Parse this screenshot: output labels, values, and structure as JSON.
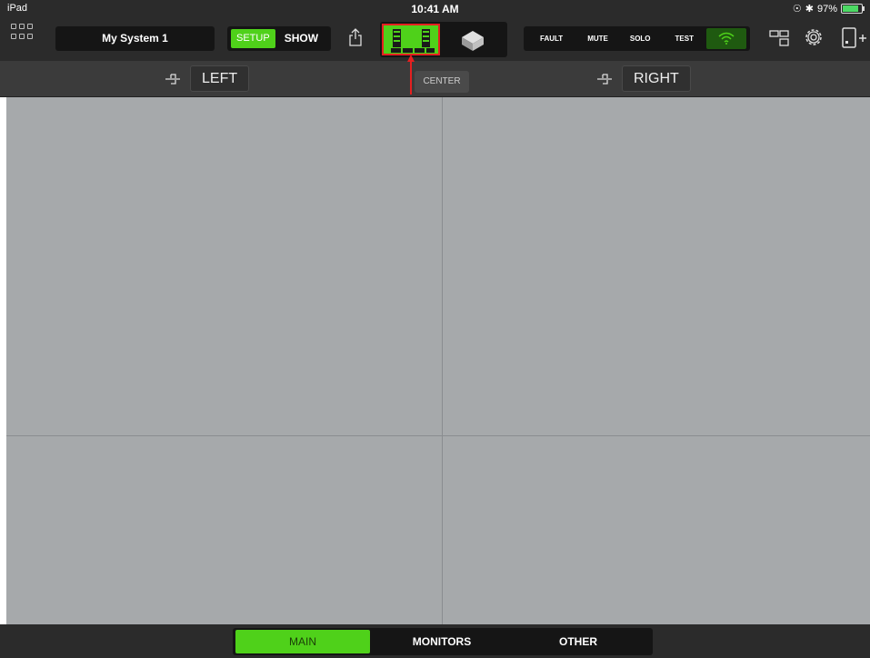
{
  "status_bar": {
    "carrier": "iPad",
    "time": "10:41 AM",
    "battery": "97%",
    "battery_level": 0.97
  },
  "toolbar": {
    "system_name": "My System 1",
    "mode": {
      "setup_label": "SETUP",
      "show_label": "SHOW",
      "selected": "SETUP"
    },
    "mute_bar": {
      "fault": "FAULT",
      "mute": "MUTE",
      "solo": "SOLO",
      "test": "TEST"
    },
    "icons": [
      "grid-icon",
      "share-icon",
      "rack-view-icon",
      "cube-3d-icon",
      "wifi-icon",
      "layout-icon",
      "gear-icon",
      "add-device-icon"
    ],
    "accent_color": "#4fd11a",
    "highlight_color": "#e52020"
  },
  "groups": {
    "left_label": "LEFT",
    "center_label": "CENTER",
    "right_label": "RIGHT"
  },
  "bottom_tabs": {
    "main": "MAIN",
    "monitors": "MONITORS",
    "other": "OTHER",
    "selected": "MAIN"
  }
}
